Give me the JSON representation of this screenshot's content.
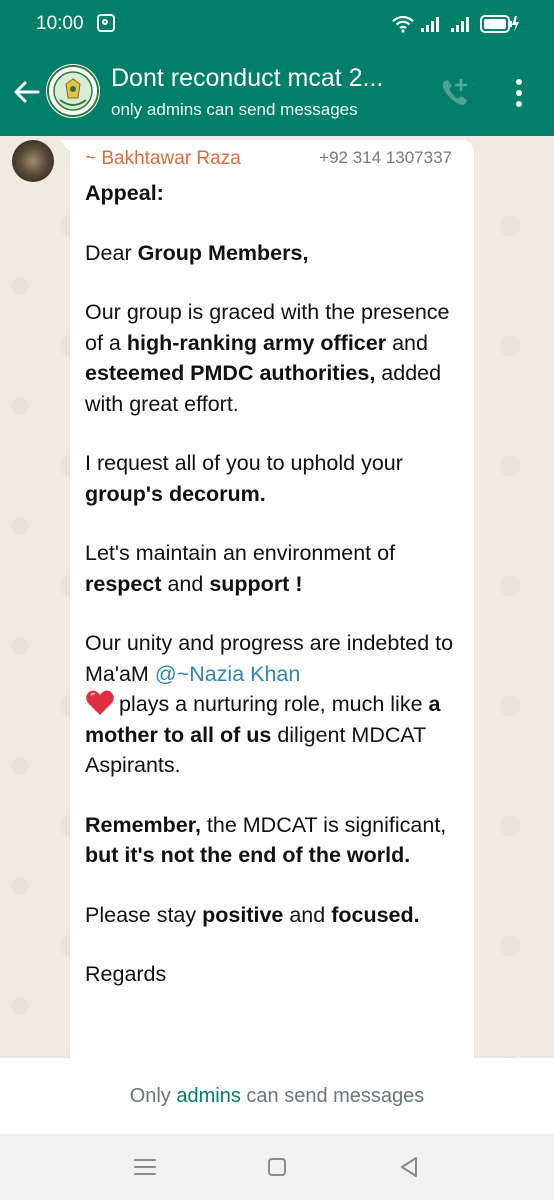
{
  "status_bar": {
    "time": "10:00"
  },
  "header": {
    "title": "Dont reconduct mcat 2...",
    "subtitle": "only admins can send messages"
  },
  "message": {
    "sender_name": "~ Bakhtawar Raza",
    "sender_phone": "+92 314 1307337",
    "heading": "Appeal:",
    "dear_prefix": "Dear ",
    "dear_bold": "Group Members,",
    "p1_a": "Our group is graced with the presence of a ",
    "p1_b": "high-ranking army officer",
    "p1_c": " and ",
    "p1_d": "esteemed PMDC authorities,",
    "p1_e": " added with great effort.",
    "p2_a": "I request all of you to uphold your ",
    "p2_b": "group's decorum.",
    "p3_a": "Let's maintain an environment of ",
    "p3_b": "respect",
    "p3_c": " and ",
    "p3_d": "support !",
    "p4_a": "Our unity and progress are indebted to Ma'aM ",
    "p4_mention": "@~Nazia Khan",
    "p4_b": "plays a nurturing role, much like ",
    "p4_c": "a mother to all of us",
    "p4_d": " diligent MDCAT Aspirants.",
    "p5_a": "Remember,",
    "p5_b": " the MDCAT is significant, ",
    "p5_c": "but it's not the end of the world.",
    "p6_a": "Please stay ",
    "p6_b": "positive",
    "p6_c": " and ",
    "p6_d": "focused.",
    "regards": "Regards"
  },
  "footer": {
    "text_a": "Only ",
    "text_link": "admins",
    "text_b": " can send messages"
  },
  "colors": {
    "brand": "#008069",
    "sender_name": "#e26b3a",
    "mention": "#2f86b6"
  },
  "icons": [
    "back-arrow-icon",
    "group-logo-icon",
    "add-call-icon",
    "more-options-icon",
    "heart-icon",
    "wifi-icon",
    "signal-icon",
    "battery-icon",
    "menu-nav-icon",
    "home-nav-icon",
    "back-nav-icon"
  ]
}
